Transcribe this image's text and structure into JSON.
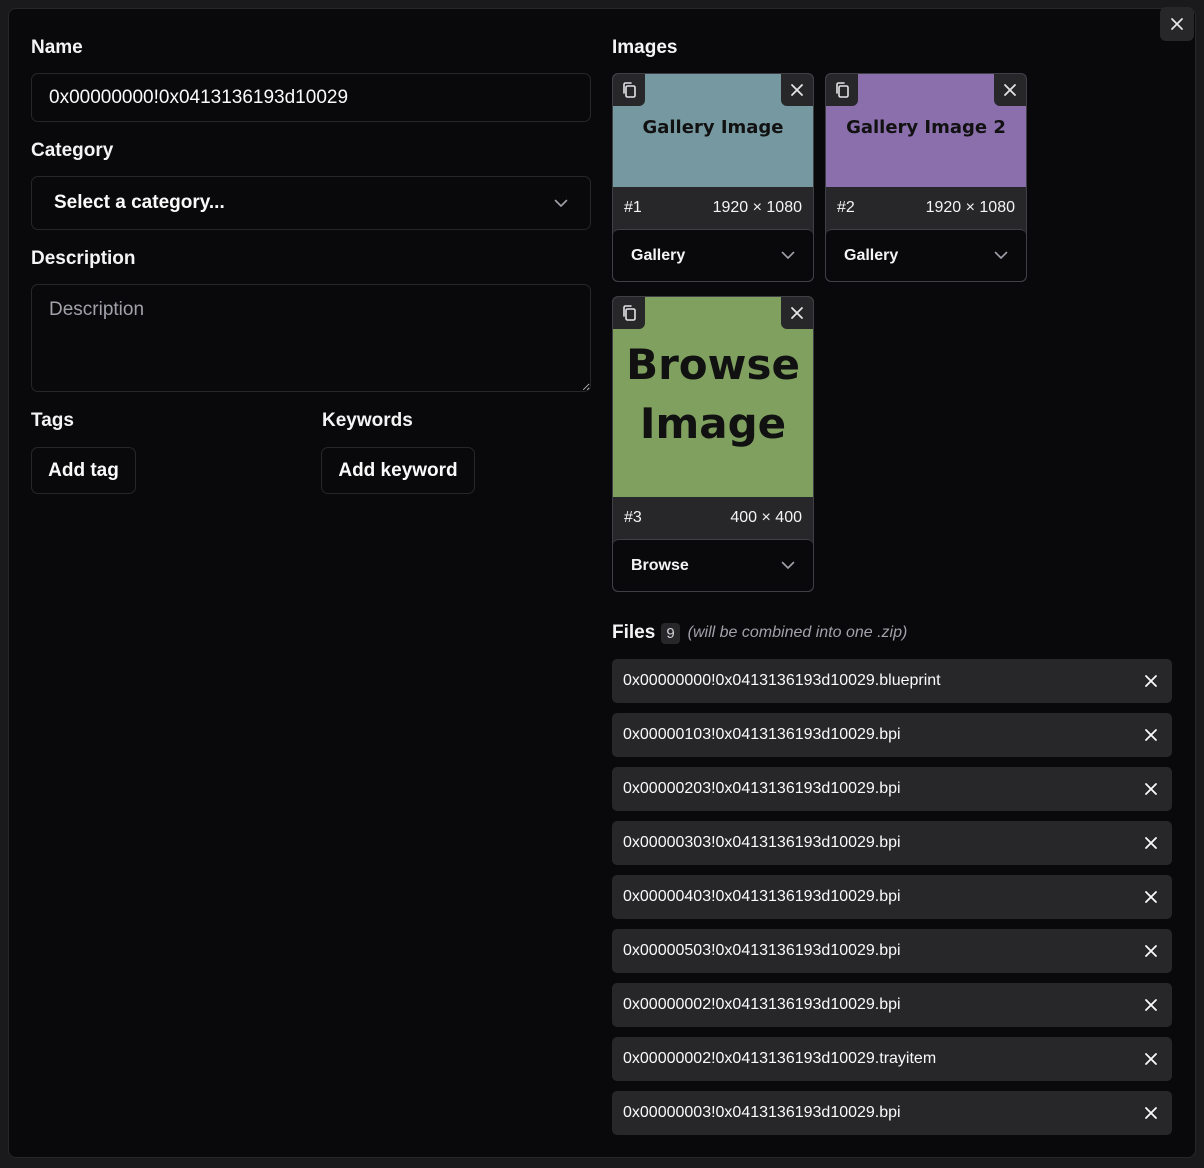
{
  "form": {
    "name_label": "Name",
    "name_value": "0x00000000!0x0413136193d10029",
    "category_label": "Category",
    "category_selected": "Select a category...",
    "description_label": "Description",
    "description_placeholder": "Description",
    "tags_label": "Tags",
    "add_tag_label": "Add tag",
    "keywords_label": "Keywords",
    "add_keyword_label": "Add keyword"
  },
  "images": {
    "label": "Images",
    "items": [
      {
        "index": "#1",
        "size": "1920 × 1080",
        "type": "Gallery",
        "preview_text": "Gallery Image",
        "color": "#7698a0"
      },
      {
        "index": "#2",
        "size": "1920 × 1080",
        "type": "Gallery",
        "preview_text": "Gallery Image 2",
        "color": "#8b6eac"
      },
      {
        "index": "#3",
        "size": "400 × 400",
        "type": "Browse",
        "preview_text": "Browse Image",
        "color": "#80a05f"
      }
    ]
  },
  "files": {
    "label": "Files",
    "count": "9",
    "note": "(will be combined into one .zip)",
    "items": [
      "0x00000000!0x0413136193d10029.blueprint",
      "0x00000103!0x0413136193d10029.bpi",
      "0x00000203!0x0413136193d10029.bpi",
      "0x00000303!0x0413136193d10029.bpi",
      "0x00000403!0x0413136193d10029.bpi",
      "0x00000503!0x0413136193d10029.bpi",
      "0x00000002!0x0413136193d10029.bpi",
      "0x00000002!0x0413136193d10029.trayitem",
      "0x00000003!0x0413136193d10029.bpi"
    ]
  },
  "icons": {
    "close": "close-icon",
    "chevron": "chevron-down-icon",
    "copy": "copy-icon"
  }
}
